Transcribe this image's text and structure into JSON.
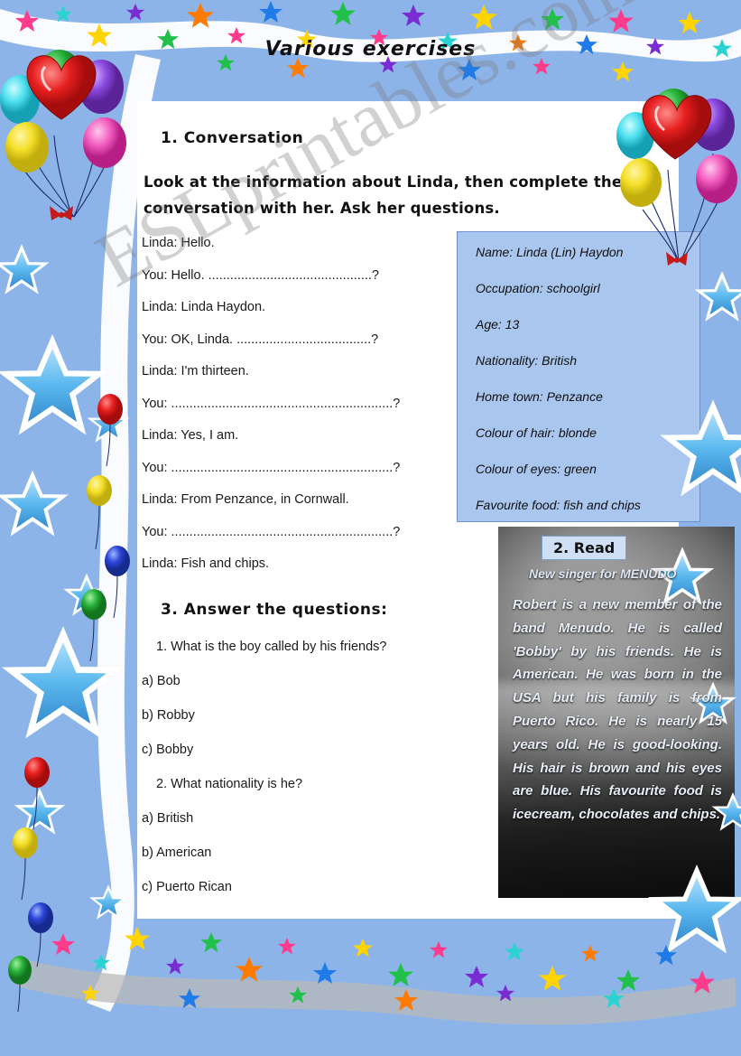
{
  "document": {
    "title": "Various exercises",
    "watermark": "ESLprintables.com"
  },
  "section1": {
    "heading": "1. Conversation",
    "instruction_line1": "Look at the information about Linda, then complete the",
    "instruction_line2": "conversation with her. Ask her questions.",
    "dialogue": [
      "Linda: Hello.",
      "You: Hello. .............................................?",
      "Linda: Linda Haydon.",
      "You: OK, Linda. .....................................?",
      "Linda: I'm thirteen.",
      "You: .............................................................?",
      "Linda: Yes, I am.",
      "You: .............................................................?",
      "Linda: From Penzance, in Cornwall.",
      "You: .............................................................?",
      "Linda: Fish and chips."
    ]
  },
  "info_card": {
    "rows": [
      {
        "label": "Name:",
        "value": "Linda (Lin) Haydon"
      },
      {
        "label": "Occupation:",
        "value": "schoolgirl"
      },
      {
        "label": "Age:",
        "value": "13"
      },
      {
        "label": "Nationality:",
        "value": "British"
      },
      {
        "label": "Home town:",
        "value": "Penzance"
      },
      {
        "label": "Colour of hair:",
        "value": "blonde"
      },
      {
        "label": "Colour of eyes:",
        "value": "green"
      },
      {
        "label": "Favourite food:",
        "value": "fish and chips"
      }
    ]
  },
  "section2": {
    "badge": "2. Read",
    "subtitle": "New singer for MENUDO",
    "body": "Robert is a new member of the band Menudo. He is called 'Bobby' by his friends. He is American. He was born in the USA but his family is from Puerto Rico. He is nearly 15 years old. He is good-looking. His hair is brown and his eyes are blue. His favourite food is icecream, chocolates and chips."
  },
  "section3": {
    "heading": "3. Answer the questions:",
    "questions": [
      {
        "number": "1. What is the boy called by his friends?",
        "options": [
          "a) Bob",
          "b) Robby",
          "c) Bobby"
        ]
      },
      {
        "number": "2. What nationality is he?",
        "options": [
          "a) British",
          "b) American",
          "c) Puerto Rican"
        ]
      }
    ]
  },
  "colors": {
    "page_background": "#8db4e8",
    "sheet": "#ffffff",
    "info_card": "#a9c6ee",
    "photo": "#3a3a3a"
  }
}
